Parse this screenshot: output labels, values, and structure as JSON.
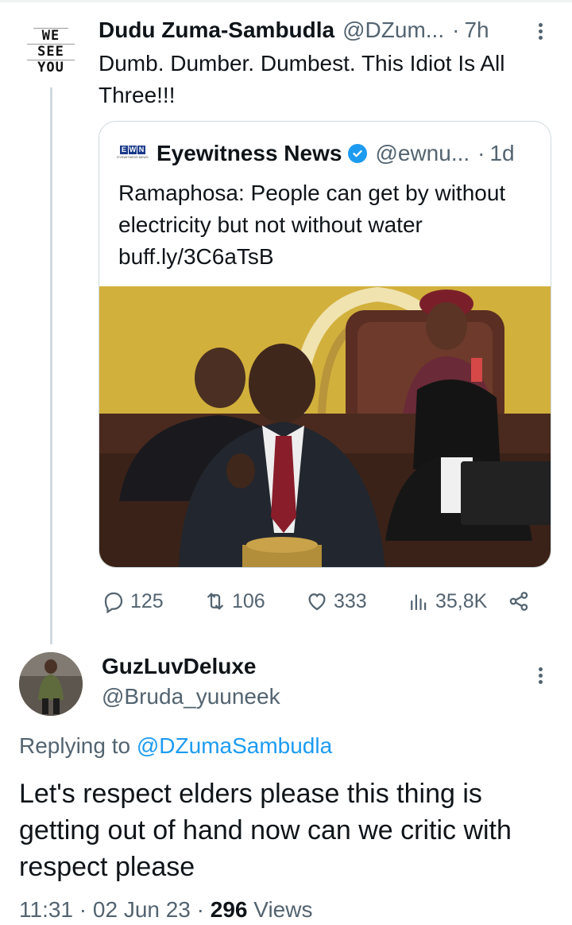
{
  "tweet": {
    "author_name": "Dudu Zuma-Sambudla",
    "author_handle": "@DZum...",
    "separator": "·",
    "time": "7h",
    "text": "Dumb. Dumber. Dumbest. This Idiot Is All Three!!!",
    "avatar_text": [
      "WE",
      "SEE",
      "YOU"
    ]
  },
  "quote": {
    "logo_letters": [
      "E",
      "W",
      "N"
    ],
    "logo_subtext": "EYEWITNESS NEWS",
    "author_name": "Eyewitness News",
    "verified": true,
    "author_handle": "@ewnu...",
    "separator": "·",
    "time": "1d",
    "text": "Ramaphosa: People can get by without electricity but not without water buff.ly/3C6aTsB"
  },
  "actions": {
    "replies": "125",
    "retweets": "106",
    "likes": "333",
    "views": "35,8K"
  },
  "reply": {
    "author_name": "GuzLuvDeluxe",
    "author_handle": "@Bruda_yuuneek",
    "replying_prefix": "Replying to",
    "replying_to": "@DZumaSambudla",
    "text": "Let's respect elders please this thing is getting out of hand now can we critic with respect please",
    "time": "11:31",
    "date": "02 Jun 23",
    "views_count": "296",
    "views_label": "Views",
    "separator": "·"
  },
  "colors": {
    "text_primary": "#0f1419",
    "text_secondary": "#536471",
    "accent": "#1d9bf0",
    "border": "#cfd9de"
  }
}
